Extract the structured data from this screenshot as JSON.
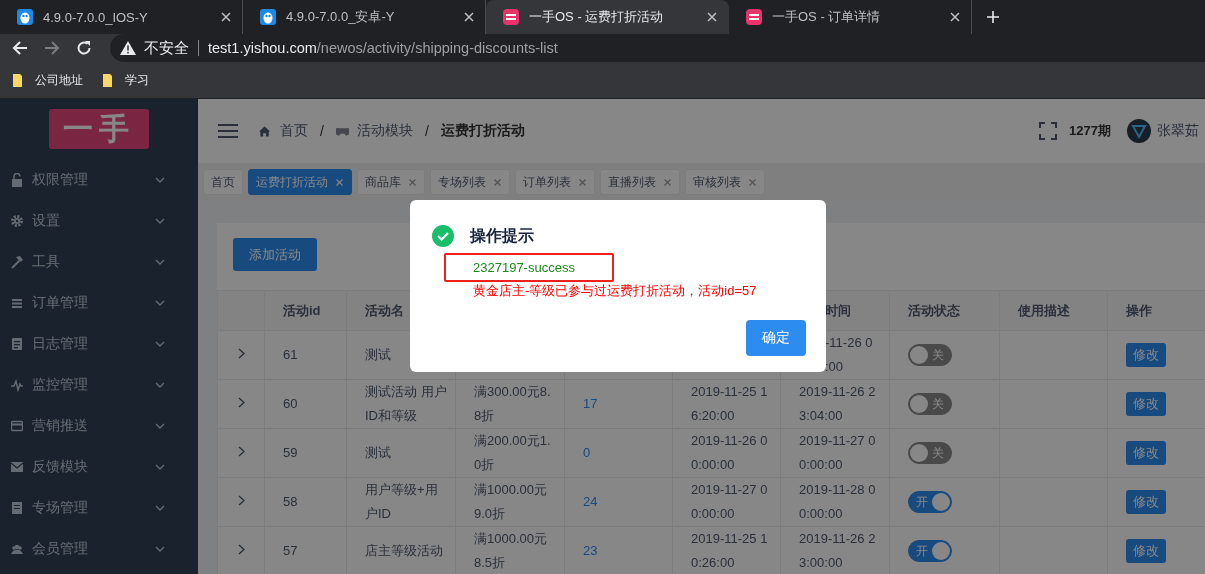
{
  "browser": {
    "tabs": [
      {
        "title": "4.9.0-7.0.0_IOS-Y",
        "kind": "mascot",
        "selected": false
      },
      {
        "title": "4.9.0-7.0.0_安卓-Y",
        "kind": "mascot",
        "selected": false
      },
      {
        "title": "一手OS - 运费打折活动",
        "kind": "brand",
        "selected": true
      },
      {
        "title": "一手OS - 订单详情",
        "kind": "brand",
        "selected": false
      }
    ],
    "nav": [
      {
        "kind": "back",
        "disabled": false
      },
      {
        "kind": "forward",
        "disabled": true
      },
      {
        "kind": "reload",
        "disabled": false
      }
    ],
    "address": {
      "security": "不安全",
      "host": "test1.yishou.com",
      "path": "/newos/activity/shipping-discounts-list"
    },
    "bookmarks": [
      {
        "label": "公司地址"
      },
      {
        "label": "学习"
      }
    ]
  },
  "sidebar": {
    "logo": "一手",
    "items": [
      {
        "label": "权限管理",
        "expanded": false
      },
      {
        "label": "设置",
        "expanded": false
      },
      {
        "label": "工具",
        "expanded": false
      },
      {
        "label": "订单管理",
        "expanded": false
      },
      {
        "label": "日志管理",
        "expanded": false
      },
      {
        "label": "监控管理",
        "expanded": false
      },
      {
        "label": "营销推送",
        "expanded": false
      },
      {
        "label": "反馈模块",
        "expanded": false
      },
      {
        "label": "专场管理",
        "expanded": false
      },
      {
        "label": "会员管理",
        "expanded": false
      }
    ]
  },
  "header": {
    "breadcrumb": [
      {
        "label": "首页",
        "current": false
      },
      {
        "label": "活动模块",
        "current": false
      },
      {
        "label": "运费打折活动",
        "current": true
      }
    ],
    "separator": "/",
    "period": "1277期",
    "user": "张翠茹"
  },
  "tags": [
    {
      "label": "首页",
      "selected": false,
      "closable": false
    },
    {
      "label": "运费打折活动",
      "selected": true,
      "closable": true
    },
    {
      "label": "商品库",
      "selected": false,
      "closable": true
    },
    {
      "label": "专场列表",
      "selected": false,
      "closable": true
    },
    {
      "label": "订单列表",
      "selected": false,
      "closable": true
    },
    {
      "label": "直播列表",
      "selected": false,
      "closable": true
    },
    {
      "label": "审核列表",
      "selected": false,
      "closable": true
    }
  ],
  "content": {
    "add_button": "添加活动",
    "table": {
      "columns": [
        {},
        {
          "label": "活动id"
        },
        {
          "label": "活动名"
        },
        {},
        {},
        {},
        {
          "label": "时间"
        },
        {
          "label": "活动状态"
        },
        {
          "label": "使用描述"
        },
        {
          "label": "操作"
        }
      ],
      "rows": [
        {
          "id": "61",
          "name": "测试",
          "end": "-11-26 0\n:00",
          "status": {
            "on": false,
            "label": "关"
          },
          "action": "修改"
        },
        {
          "id": "60",
          "name": "测试活动 用户ID和等级",
          "rule": "满300.00元8.8折",
          "count": "17",
          "start": "2019-11-25 16:20:00",
          "end": "2019-11-26 23:04:00",
          "status": {
            "on": false,
            "label": "关"
          },
          "action": "修改"
        },
        {
          "id": "59",
          "name": "测试",
          "rule": "满200.00元1.0折",
          "count": "0",
          "start": "2019-11-26 00:00:00",
          "end": "2019-11-27 00:00:00",
          "status": {
            "on": false,
            "label": "关"
          },
          "action": "修改"
        },
        {
          "id": "58",
          "name": "用户等级+用户ID",
          "rule": "满1000.00元9.0折",
          "count": "24",
          "start": "2019-11-27 00:00:00",
          "end": "2019-11-28 00:00:00",
          "status": {
            "on": true,
            "label": "开"
          },
          "action": "修改"
        },
        {
          "id": "57",
          "name": "店主等级活动",
          "rule": "满1000.00元8.5折",
          "count": "23",
          "start": "2019-11-25 10:26:00",
          "end": "2019-11-26 23:00:00",
          "status": {
            "on": true,
            "label": "开"
          },
          "action": "修改"
        }
      ]
    }
  },
  "dialog": {
    "title": "操作提示",
    "lines": [
      {
        "text": "2327197-success",
        "kind": "ok",
        "highlighted": true
      },
      {
        "text": "黄金店主-等级已参与过运费打折活动，活动id=57",
        "kind": "error",
        "highlighted": false
      }
    ],
    "confirm": "确定"
  }
}
